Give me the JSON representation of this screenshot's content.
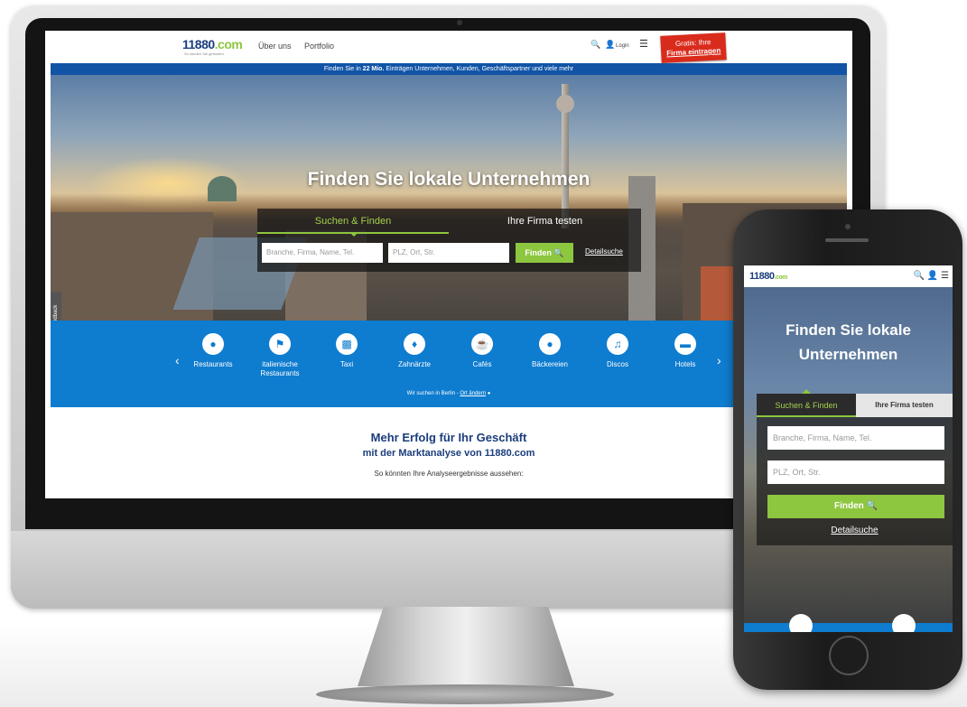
{
  "desktop": {
    "logo": {
      "text": "11880",
      "dot_suffix": ".com",
      "tagline": "So werden Sie gefunden"
    },
    "nav": {
      "about": "Über uns",
      "portfolio": "Portfolio",
      "login": "Login"
    },
    "ribbon": {
      "line1": "Gratis: Ihre",
      "line2": "Firma eintragen"
    },
    "infobar": {
      "before": "Finden Sie in ",
      "bold": "22 Mio.",
      "after": " Einträgen Unternehmen, Kunden, Geschäftspartner und viele mehr"
    },
    "hero_title": "Finden Sie lokale Unternehmen",
    "tabs": {
      "search": "Suchen & Finden",
      "test": "Ihre Firma testen"
    },
    "search": {
      "what_placeholder": "Branche, Firma, Name, Tel.",
      "where_placeholder": "PLZ, Ort, Str.",
      "button": "Finden",
      "detail": "Detailsuche"
    },
    "feedback": "Feedback",
    "categories": [
      {
        "label": "Restaurants",
        "icon": "plate-icon"
      },
      {
        "label": "italienische Restaurants",
        "icon": "italy-flag-icon"
      },
      {
        "label": "Taxi",
        "icon": "car-icon"
      },
      {
        "label": "Zahnärzte",
        "icon": "tooth-icon"
      },
      {
        "label": "Cafés",
        "icon": "coffee-icon"
      },
      {
        "label": "Bäckereien",
        "icon": "bread-icon"
      },
      {
        "label": "Discos",
        "icon": "dance-icon"
      },
      {
        "label": "Hotels",
        "icon": "bed-icon"
      }
    ],
    "location": {
      "text": "Wir suchen in Berlin - ",
      "link": "Ort ändern"
    },
    "promo": {
      "title": "Mehr Erfolg für Ihr Geschäft",
      "subtitle": "mit der Marktanalyse von 11880.com",
      "text": "So könnten Ihre Analyseergebnisse aussehen:"
    }
  },
  "mobile": {
    "logo": "11880",
    "logo_suffix": ".com",
    "hero_title": "Finden Sie lokale Unternehmen",
    "tabs": {
      "search": "Suchen & Finden",
      "test": "Ihre Firma testen"
    },
    "search": {
      "what_placeholder": "Branche, Firma, Name, Tel.",
      "where_placeholder": "PLZ, Ort, Str.",
      "button": "Finden",
      "detail": "Detailsuche"
    }
  },
  "colors": {
    "brand_blue": "#1a3d7c",
    "accent_green": "#8dc63f",
    "category_blue": "#0e7ccf",
    "ribbon_red": "#d92b1c"
  }
}
